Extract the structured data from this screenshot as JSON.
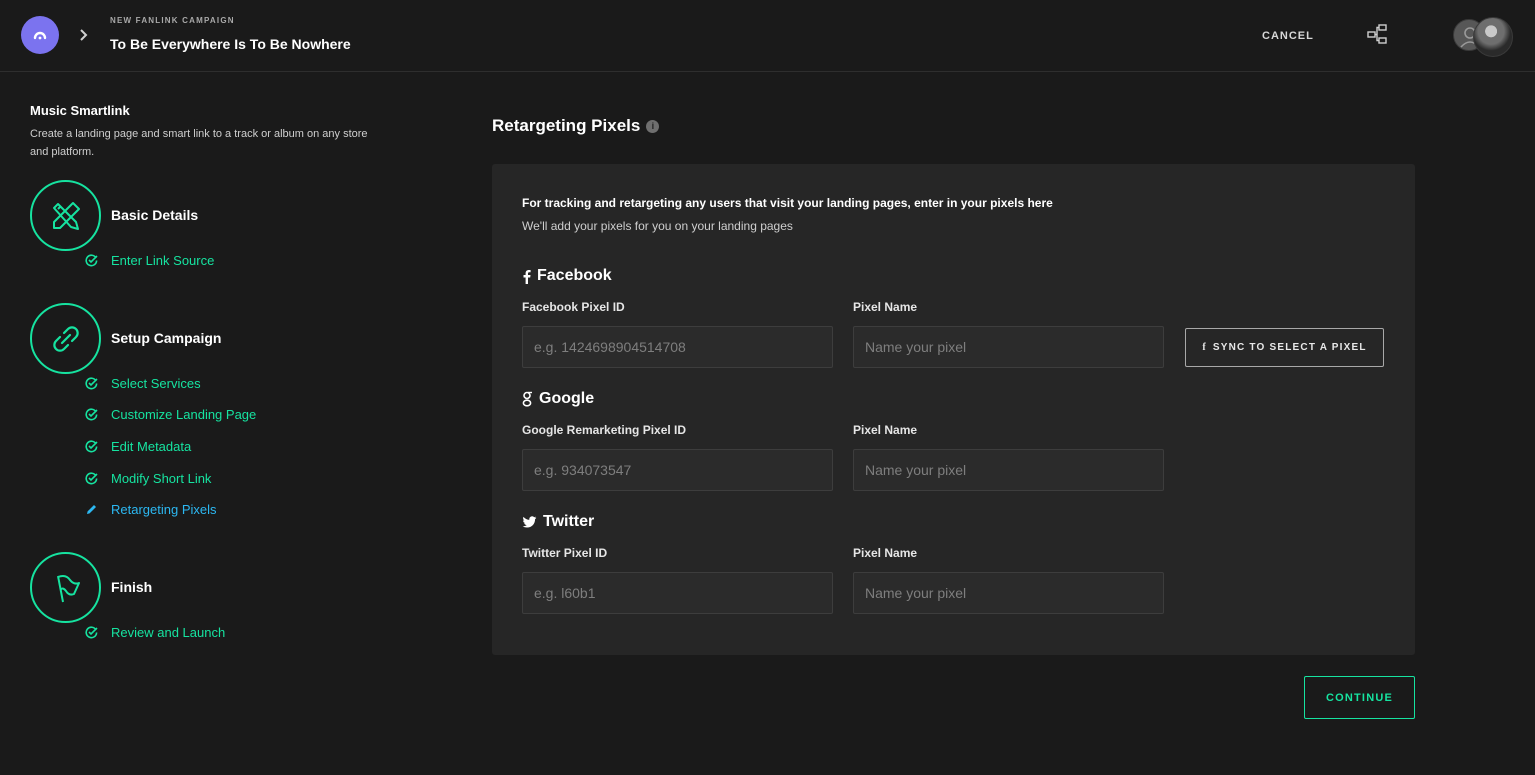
{
  "header": {
    "eyebrow": "NEW FANLINK CAMPAIGN",
    "title": "To Be Everywhere Is To Be Nowhere",
    "cancel_label": "CANCEL"
  },
  "sidebar": {
    "title": "Music Smartlink",
    "description": "Create a landing page and smart link to a track or album on any store and platform.",
    "steps": [
      {
        "title": "Basic Details",
        "icon": "tools-icon",
        "substeps": [
          {
            "label": "Enter Link Source",
            "status": "done"
          }
        ]
      },
      {
        "title": "Setup Campaign",
        "icon": "link-icon",
        "substeps": [
          {
            "label": "Select Services",
            "status": "done"
          },
          {
            "label": "Customize Landing Page",
            "status": "done"
          },
          {
            "label": "Edit Metadata",
            "status": "done"
          },
          {
            "label": "Modify Short Link",
            "status": "done"
          },
          {
            "label": "Retargeting Pixels",
            "status": "active"
          }
        ]
      },
      {
        "title": "Finish",
        "icon": "flag-icon",
        "substeps": [
          {
            "label": "Review and Launch",
            "status": "done"
          }
        ]
      }
    ]
  },
  "main": {
    "title": "Retargeting Pixels",
    "info_glyph": "i",
    "card": {
      "heading": "For tracking and retargeting any users that visit your landing pages, enter in your pixels here",
      "subheading": "We'll add your pixels for you on your landing pages",
      "sections": [
        {
          "name": "Facebook",
          "icon": "facebook-icon",
          "id_label": "Facebook Pixel ID",
          "id_placeholder": "e.g. 1424698904514708",
          "name_label": "Pixel Name",
          "name_placeholder": "Name your pixel",
          "sync_label": "SYNC TO SELECT A PIXEL"
        },
        {
          "name": "Google",
          "icon": "google-icon",
          "id_label": "Google Remarketing Pixel ID",
          "id_placeholder": "e.g. 934073547",
          "name_label": "Pixel Name",
          "name_placeholder": "Name your pixel"
        },
        {
          "name": "Twitter",
          "icon": "twitter-icon",
          "id_label": "Twitter Pixel ID",
          "id_placeholder": "e.g. l60b1",
          "name_label": "Pixel Name",
          "name_placeholder": "Name your pixel"
        }
      ]
    },
    "continue_label": "CONTINUE"
  },
  "colors": {
    "background": "#1a1a1a",
    "card": "#262626",
    "accent_green": "#16e3a0",
    "active_blue": "#2cb8f2",
    "logo_purple": "#7b73ef"
  }
}
